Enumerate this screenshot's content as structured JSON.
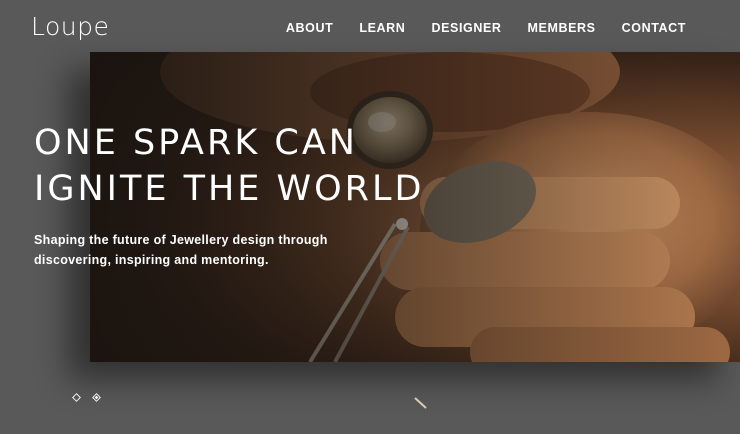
{
  "header": {
    "logo_text": "Loupe",
    "nav": [
      "ABOUT",
      "LEARN",
      "DESIGNER",
      "MEMBERS",
      "CONTACT"
    ]
  },
  "hero": {
    "headline_lines": [
      "ONE SPARK CAN",
      "IGNITE THE WORLD"
    ],
    "subhead_lines": [
      "Shaping the future of Jewellery design through",
      "discovering, inspiring and mentoring."
    ]
  },
  "slider": {
    "slide_count": 2,
    "active_index": 1
  },
  "colors": {
    "background": "#595959",
    "text": "#ffffff",
    "hero_warm": "#b9855a",
    "hero_dark": "#1f1612"
  },
  "icons": {
    "slide_dot": "diamond-outline",
    "active_slide_dot": "diamond-filled-center",
    "scroll": "diagonal-line"
  }
}
